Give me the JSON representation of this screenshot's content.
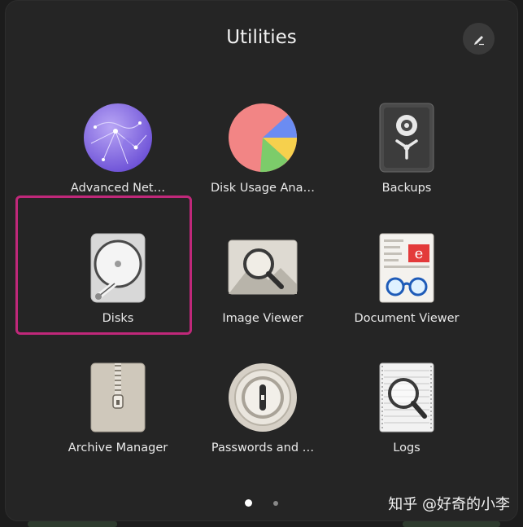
{
  "window": {
    "title": "Utilities"
  },
  "apps": [
    {
      "label": "Advanced Net…",
      "icon": "network-globe-icon"
    },
    {
      "label": "Disk Usage Ana…",
      "icon": "pie-chart-icon"
    },
    {
      "label": "Backups",
      "icon": "safe-icon"
    },
    {
      "label": "Disks",
      "icon": "hard-disk-icon",
      "selected": true
    },
    {
      "label": "Image Viewer",
      "icon": "image-magnifier-icon"
    },
    {
      "label": "Document Viewer",
      "icon": "document-glasses-icon"
    },
    {
      "label": "Archive Manager",
      "icon": "archive-zipper-icon"
    },
    {
      "label": "Passwords and …",
      "icon": "keyhole-icon"
    },
    {
      "label": "Logs",
      "icon": "log-magnifier-icon"
    }
  ],
  "pager": {
    "pages": 2,
    "current": 1
  },
  "watermark": "知乎 @好奇的小李",
  "colors": {
    "selection": "#c0287a",
    "background": "#252525"
  }
}
